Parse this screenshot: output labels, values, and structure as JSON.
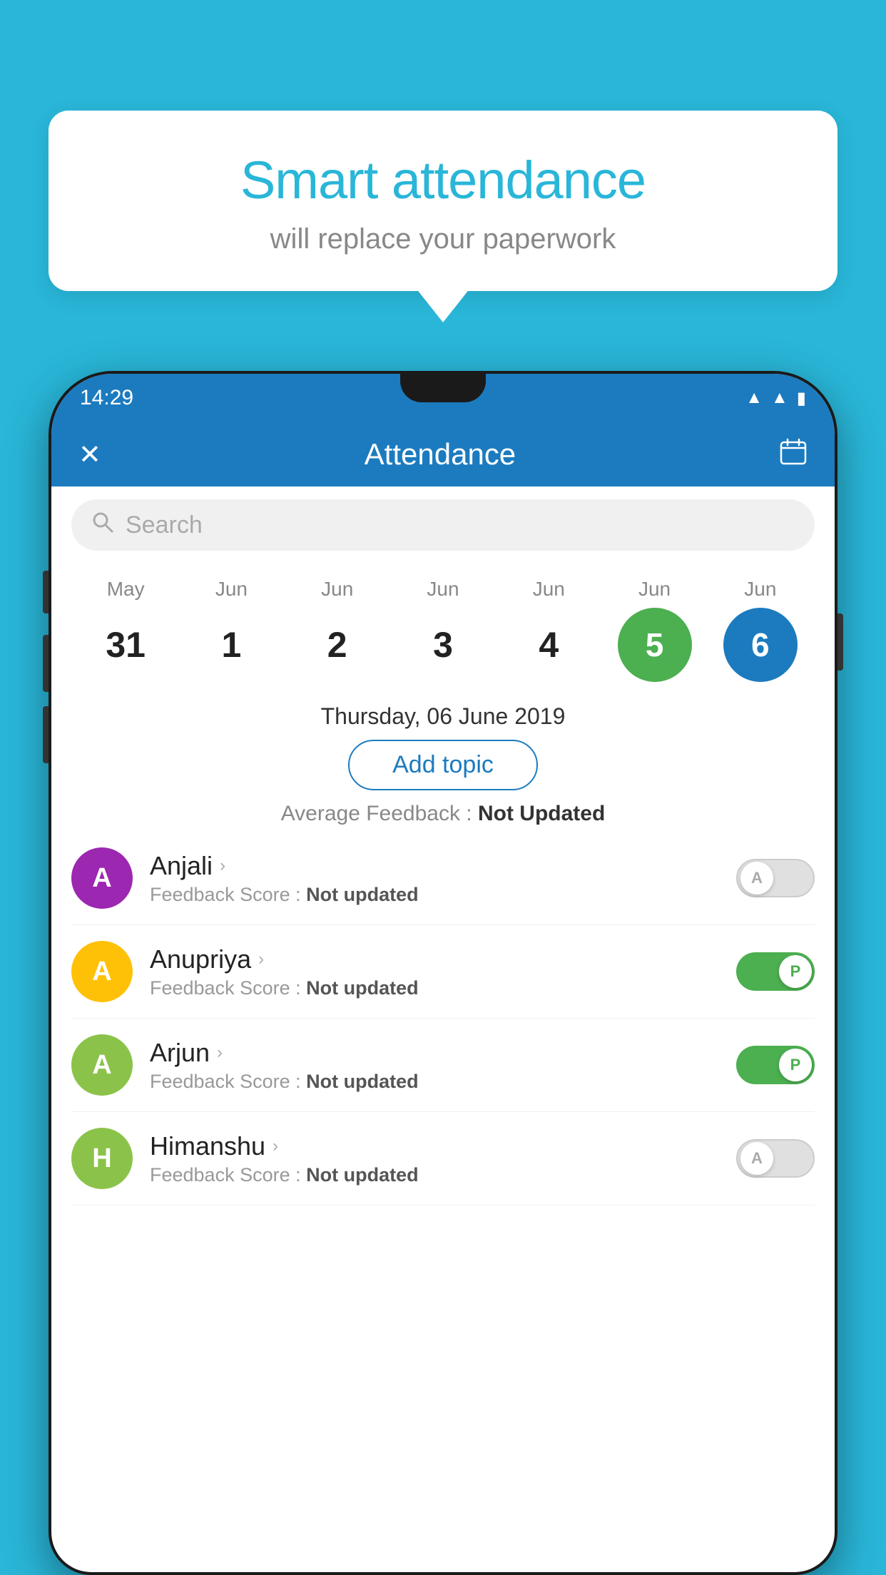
{
  "background_color": "#29b6d8",
  "bubble": {
    "title": "Smart attendance",
    "subtitle": "will replace your paperwork"
  },
  "status_bar": {
    "time": "14:29",
    "wifi_icon": "wifi-icon",
    "signal_icon": "signal-icon",
    "battery_icon": "battery-icon"
  },
  "header": {
    "close_label": "✕",
    "title": "Attendance",
    "calendar_icon": "calendar-icon"
  },
  "search": {
    "placeholder": "Search"
  },
  "calendar": {
    "months": [
      "May",
      "Jun",
      "Jun",
      "Jun",
      "Jun",
      "Jun",
      "Jun"
    ],
    "days": [
      "31",
      "1",
      "2",
      "3",
      "4",
      "5",
      "6"
    ],
    "today_index": 5,
    "selected_index": 6,
    "selected_date": "Thursday, 06 June 2019"
  },
  "add_topic_button": "Add topic",
  "average_feedback": {
    "label": "Average Feedback :",
    "value": "Not Updated"
  },
  "students": [
    {
      "name": "Anjali",
      "avatar_letter": "A",
      "avatar_color": "#9c27b0",
      "feedback_label": "Feedback Score :",
      "feedback_value": "Not updated",
      "toggle_state": "off",
      "toggle_label": "A"
    },
    {
      "name": "Anupriya",
      "avatar_letter": "A",
      "avatar_color": "#ffc107",
      "feedback_label": "Feedback Score :",
      "feedback_value": "Not updated",
      "toggle_state": "on",
      "toggle_label": "P"
    },
    {
      "name": "Arjun",
      "avatar_letter": "A",
      "avatar_color": "#8bc34a",
      "feedback_label": "Feedback Score :",
      "feedback_value": "Not updated",
      "toggle_state": "on",
      "toggle_label": "P"
    },
    {
      "name": "Himanshu",
      "avatar_letter": "H",
      "avatar_color": "#8bc34a",
      "feedback_label": "Feedback Score :",
      "feedback_value": "Not updated",
      "toggle_state": "off",
      "toggle_label": "A"
    }
  ]
}
